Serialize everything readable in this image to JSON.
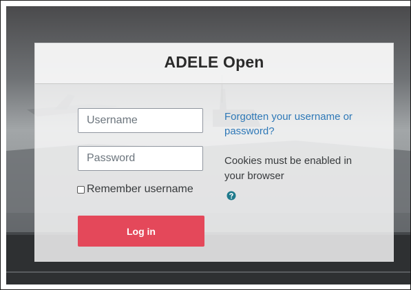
{
  "site": {
    "title": "ADELE Open"
  },
  "login": {
    "username_placeholder": "Username",
    "username_value": "",
    "password_placeholder": "Password",
    "password_value": "",
    "remember_label": "Remember username",
    "remember_checked": false,
    "login_button": "Log in",
    "forgot_link": "Forgotten your username or password?",
    "cookies_notice": "Cookies must be enabled in your browser",
    "help_icon": "question-circle-icon"
  },
  "colors": {
    "accent": "#e4485a",
    "link": "#2e78b7",
    "help_icon": "#1f7a8c"
  }
}
